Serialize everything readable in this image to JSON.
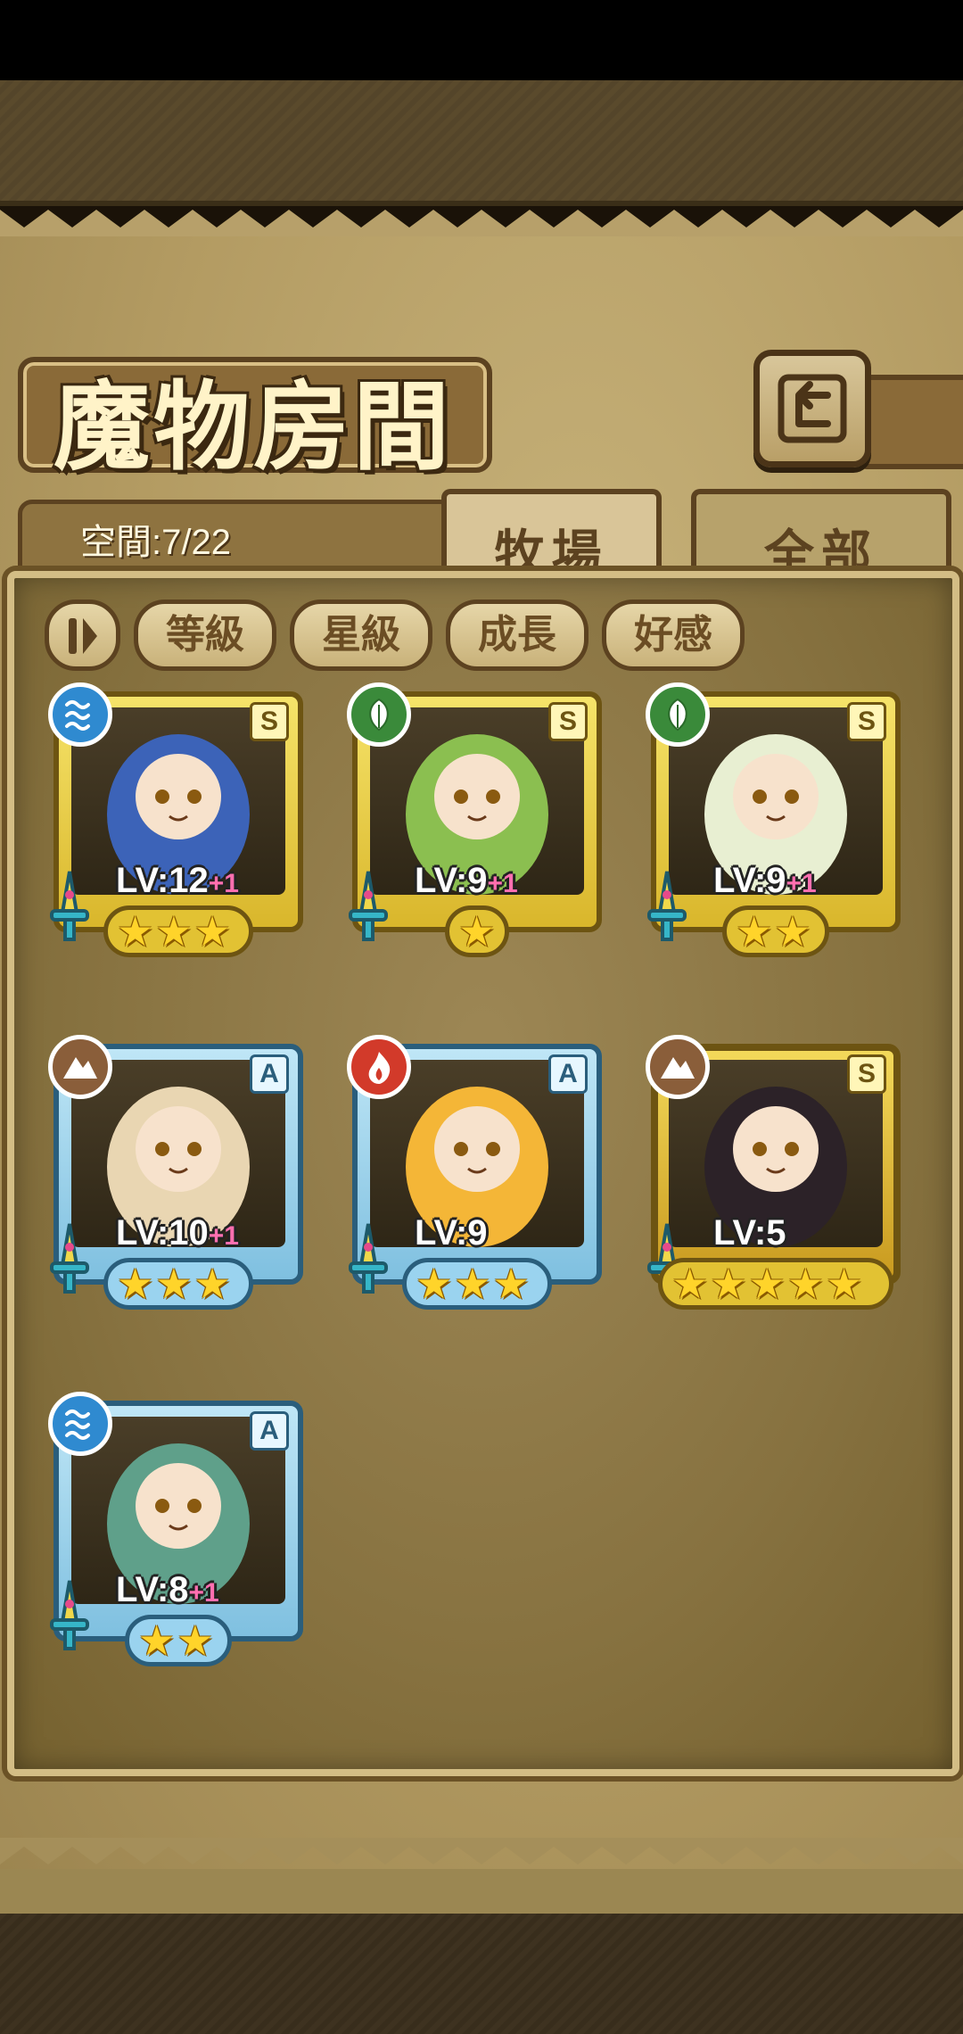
{
  "title": "魔物房間",
  "space_label": "空間:7/22",
  "tabs": [
    {
      "label": "牧場",
      "active": true
    },
    {
      "label": "全部",
      "active": false
    }
  ],
  "filters": [
    "等級",
    "星級",
    "成長",
    "好感"
  ],
  "monsters": [
    {
      "rank": "S",
      "element": "water",
      "level": "LV:12",
      "bonus": "+1",
      "stars": 3,
      "frame": "gold",
      "color": "#3c63b8"
    },
    {
      "rank": "S",
      "element": "leaf",
      "level": "LV:9",
      "bonus": "+1",
      "stars": 1,
      "frame": "gold",
      "color": "#8bbf50"
    },
    {
      "rank": "S",
      "element": "leaf",
      "level": "LV:9",
      "bonus": "+1",
      "stars": 2,
      "frame": "gold",
      "color": "#e8efd2"
    },
    {
      "rank": "A",
      "element": "earth",
      "level": "LV:10",
      "bonus": "+1",
      "stars": 3,
      "frame": "blue",
      "color": "#e9d6b2"
    },
    {
      "rank": "A",
      "element": "fire",
      "level": "LV:9",
      "bonus": "",
      "stars": 3,
      "frame": "blue",
      "color": "#f4b637"
    },
    {
      "rank": "S",
      "element": "earth",
      "level": "LV:5",
      "bonus": "",
      "stars": 5,
      "frame": "ornate",
      "color": "#2c2228"
    },
    {
      "rank": "A",
      "element": "water",
      "level": "LV:8",
      "bonus": "+1",
      "stars": 2,
      "frame": "blue",
      "color": "#5fa08a"
    }
  ],
  "colors": {
    "water": "#2f8ad0",
    "leaf": "#3a8a3a",
    "earth": "#8a5e3a",
    "fire": "#d23a2a"
  }
}
